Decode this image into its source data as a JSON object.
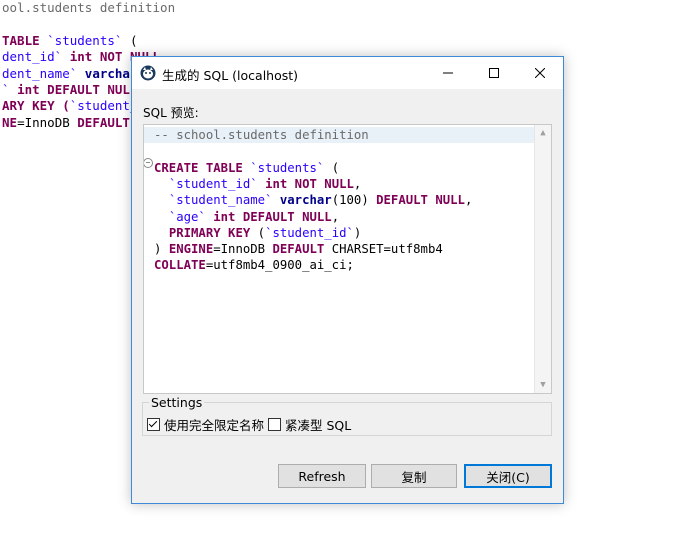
{
  "background_editor": {
    "lines": [
      [
        {
          "t": "ool.students definition",
          "c": "gray"
        }
      ],
      [],
      [
        {
          "t": "TABLE ",
          "c": "kw"
        },
        {
          "t": "`students`",
          "c": "str"
        },
        {
          "t": " (",
          "c": ""
        }
      ],
      [
        {
          "t": "dent_id`",
          "c": "str"
        },
        {
          "t": " ",
          "c": ""
        },
        {
          "t": "int NOT NULL",
          "c": "kw"
        },
        {
          "t": ",",
          "c": ""
        }
      ],
      [
        {
          "t": "dent_name`",
          "c": "str"
        },
        {
          "t": " ",
          "c": ""
        },
        {
          "t": "varchar",
          "c": "kwb"
        }
      ],
      [
        {
          "t": "` ",
          "c": "str"
        },
        {
          "t": "int DEFAULT NULL",
          "c": "kw"
        }
      ],
      [
        {
          "t": "ARY KEY (",
          "c": "kw"
        },
        {
          "t": "`student_",
          "c": "str"
        }
      ],
      [
        {
          "t": "NE",
          "c": "kw"
        },
        {
          "t": "=InnoDB ",
          "c": ""
        },
        {
          "t": "DEFAULT",
          "c": "kw"
        }
      ]
    ]
  },
  "dialog": {
    "title": "生成的 SQL (localhost)",
    "sql_preview_label": "SQL 预览:",
    "code_lines": [
      [
        {
          "t": "-- school.students definition",
          "c": "gray"
        }
      ],
      [],
      [
        {
          "t": "CREATE TABLE ",
          "c": "kw"
        },
        {
          "t": "`students`",
          "c": "str"
        },
        {
          "t": " (",
          "c": ""
        }
      ],
      [
        {
          "t": "  ",
          "c": ""
        },
        {
          "t": "`student_id`",
          "c": "str"
        },
        {
          "t": " ",
          "c": ""
        },
        {
          "t": "int NOT NULL",
          "c": "kw"
        },
        {
          "t": ",",
          "c": ""
        }
      ],
      [
        {
          "t": "  ",
          "c": ""
        },
        {
          "t": "`student_name`",
          "c": "str"
        },
        {
          "t": " ",
          "c": ""
        },
        {
          "t": "varchar",
          "c": "kwb"
        },
        {
          "t": "(100) ",
          "c": ""
        },
        {
          "t": "DEFAULT NULL",
          "c": "kw"
        },
        {
          "t": ",",
          "c": ""
        }
      ],
      [
        {
          "t": "  ",
          "c": ""
        },
        {
          "t": "`age`",
          "c": "str"
        },
        {
          "t": " ",
          "c": ""
        },
        {
          "t": "int DEFAULT NULL",
          "c": "kw"
        },
        {
          "t": ",",
          "c": ""
        }
      ],
      [
        {
          "t": "  ",
          "c": ""
        },
        {
          "t": "PRIMARY KEY",
          "c": "kw"
        },
        {
          "t": " (",
          "c": ""
        },
        {
          "t": "`student_id`",
          "c": "str"
        },
        {
          "t": ")",
          "c": ""
        }
      ],
      [
        {
          "t": ") ",
          "c": ""
        },
        {
          "t": "ENGINE",
          "c": "kw"
        },
        {
          "t": "=InnoDB ",
          "c": ""
        },
        {
          "t": "DEFAULT",
          "c": "kw"
        },
        {
          "t": " CHARSET=utf8mb4",
          "c": ""
        }
      ],
      [
        {
          "t": "COLLATE",
          "c": "kw"
        },
        {
          "t": "=utf8mb4_0900_ai_ci;",
          "c": ""
        }
      ]
    ],
    "settings_label": "Settings",
    "option_qualified": {
      "label": "使用完全限定名称",
      "checked": true
    },
    "option_compact": {
      "label": "紧凑型 SQL",
      "checked": false
    },
    "buttons": {
      "refresh": "Refresh",
      "copy": "复制",
      "close": "关闭(C)"
    }
  },
  "colors": {
    "keyword": "#7f0055",
    "string": "#2a00ff",
    "accent": "#0078d7"
  }
}
